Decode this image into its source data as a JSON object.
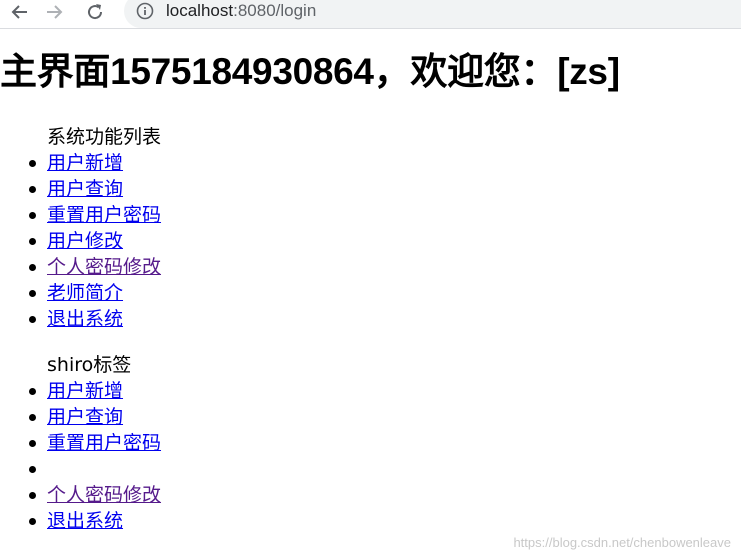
{
  "browser": {
    "url_host": "localhost",
    "url_rest": ":8080/login"
  },
  "page": {
    "heading": "主界面1575184930864，欢迎您：[zs]"
  },
  "sections": [
    {
      "title": "系统功能列表",
      "items": [
        {
          "label": "用户新增",
          "visited": false
        },
        {
          "label": "用户查询",
          "visited": false
        },
        {
          "label": "重置用户密码",
          "visited": false
        },
        {
          "label": "用户修改",
          "visited": false
        },
        {
          "label": "个人密码修改",
          "visited": true
        },
        {
          "label": "老师简介",
          "visited": false
        },
        {
          "label": "退出系统",
          "visited": false
        }
      ]
    },
    {
      "title": "shiro标签",
      "items": [
        {
          "label": "用户新增",
          "visited": false
        },
        {
          "label": "用户查询",
          "visited": false
        },
        {
          "label": "重置用户密码",
          "visited": false
        },
        {
          "label": "",
          "visited": false
        },
        {
          "label": "个人密码修改",
          "visited": true
        },
        {
          "label": "退出系统",
          "visited": false
        }
      ]
    }
  ],
  "watermark": "https://blog.csdn.net/chenbowenleave",
  "colors": {
    "link": "#0000ee",
    "visited_link": "#551a8b",
    "toolbar_icon": "#5f6368",
    "omnibox_bg": "#f1f3f4"
  },
  "icons": [
    "back-arrow-icon",
    "forward-arrow-icon",
    "reload-icon",
    "info-icon"
  ]
}
